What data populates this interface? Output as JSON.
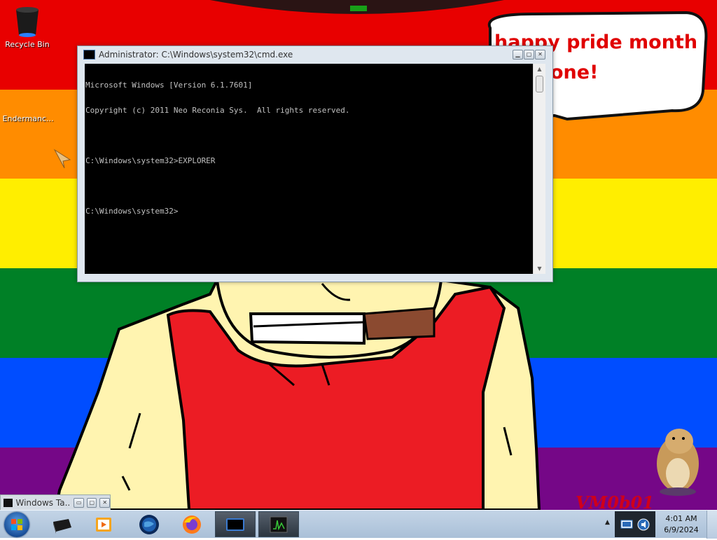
{
  "desktop": {
    "icons": [
      {
        "label": "Recycle Bin"
      },
      {
        "label": "Endermanc..."
      }
    ],
    "speech_bubble": {
      "line1": "happy pride month",
      "line2": "one!"
    },
    "watermark": "VM0b01"
  },
  "cmd_window": {
    "title": "Administrator: C:\\Windows\\system32\\cmd.exe",
    "lines": [
      "Microsoft Windows [Version 6.1.7601]",
      "Copyright (c) 2011 Neo Reconia Sys.  All rights reserved.",
      "",
      "C:\\Windows\\system32>EXPLORER",
      "",
      "C:\\Windows\\system32>"
    ]
  },
  "minimized_window": {
    "title": "Windows Ta..."
  },
  "taskbar": {
    "pinned": [
      {
        "icon": "drive-icon"
      },
      {
        "icon": "media-player-icon"
      },
      {
        "icon": "globe-icon"
      },
      {
        "icon": "firefox-icon"
      },
      {
        "icon": "cmd-icon"
      },
      {
        "icon": "task-manager-icon"
      }
    ],
    "clock": {
      "time": "4:01 AM",
      "date": "6/9/2024"
    }
  },
  "colors": {
    "rainbow": [
      "#e80000",
      "#ff8c00",
      "#ffee00",
      "#008026",
      "#004dff",
      "#750787"
    ],
    "bubble_text": "#e00000",
    "console_bg": "#000000",
    "console_text": "#c0c0c0"
  }
}
